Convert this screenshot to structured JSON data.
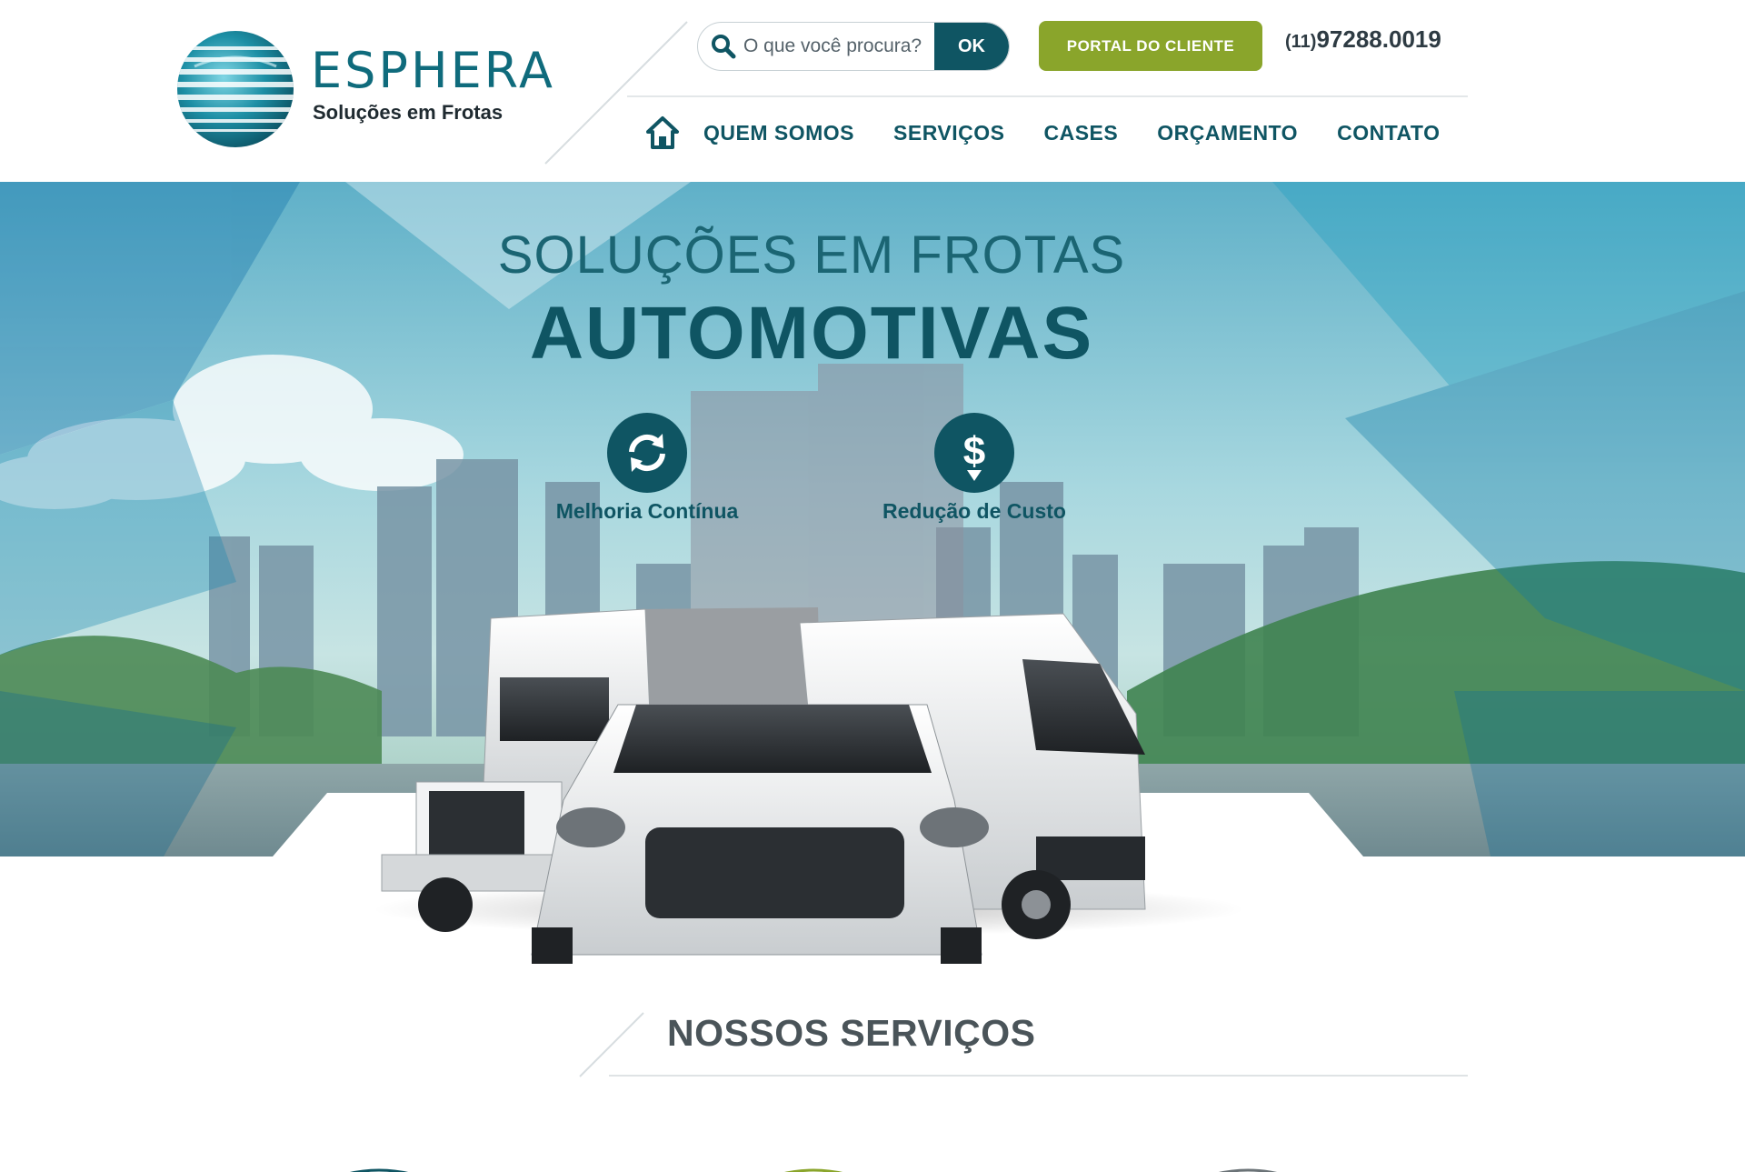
{
  "brand": {
    "name": "ESPHERA",
    "tagline": "Soluções em Frotas"
  },
  "search": {
    "placeholder": "O que você procura?",
    "submit_label": "OK"
  },
  "portal_button": "PORTAL DO CLIENTE",
  "phone": {
    "area": "(11)",
    "number": "97288.0019"
  },
  "nav": {
    "items": [
      {
        "label": "QUEM SOMOS"
      },
      {
        "label": "SERVIÇOS"
      },
      {
        "label": "CASES"
      },
      {
        "label": "ORÇAMENTO"
      },
      {
        "label": "CONTATO"
      }
    ]
  },
  "hero": {
    "subtitle": "SOLUÇÕES EM FROTAS",
    "title": "AUTOMOTIVAS",
    "features": [
      {
        "label": "Melhoria Contínua",
        "icon": "refresh-icon"
      },
      {
        "label": "Redução de Custo",
        "icon": "dollar-down-icon"
      }
    ]
  },
  "services": {
    "title_light": "NOSSOS ",
    "title_bold": "SERVIÇOS"
  },
  "colors": {
    "primary": "#0f5563",
    "accent_green": "#8aa52b",
    "text_dark": "#2e3b43",
    "heading_gray": "#4a5459"
  }
}
